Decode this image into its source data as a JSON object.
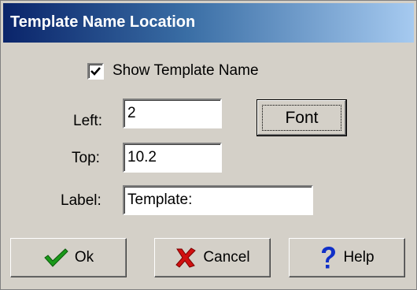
{
  "dialog": {
    "title": "Template Name Location"
  },
  "show_template_name": {
    "label": "Show Template Name",
    "checked": true
  },
  "fields": {
    "left": {
      "label": "Left:",
      "value": "2"
    },
    "top": {
      "label": "Top:",
      "value": "10.2"
    },
    "label": {
      "label": "Label:",
      "value": "Template:"
    }
  },
  "buttons": {
    "font": "Font",
    "ok": "Ok",
    "cancel": "Cancel",
    "help": "Help"
  },
  "icons": {
    "ok": "checkmark-icon",
    "cancel": "x-mark-icon",
    "help": "question-mark-icon"
  },
  "colors": {
    "dialog_background": "#d4d0c8",
    "titlebar_start": "#0a246a",
    "titlebar_end": "#a6caf0",
    "ok_icon": "#1a9a1a",
    "cancel_icon": "#d01010",
    "help_icon": "#1030c8"
  }
}
